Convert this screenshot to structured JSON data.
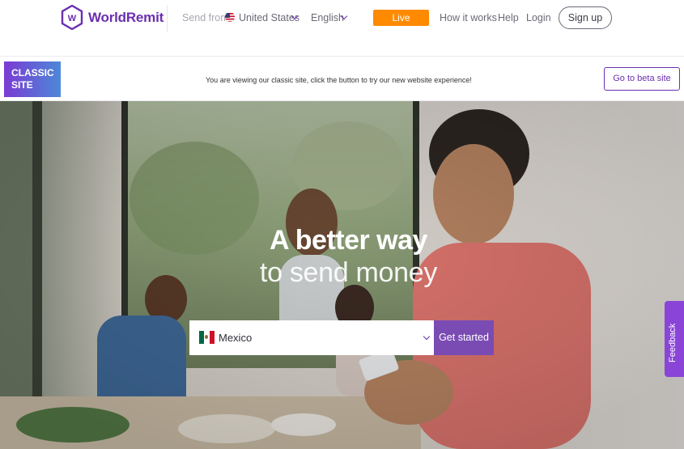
{
  "header": {
    "logo_text": "WorldRemit",
    "send_from_label": "Send from:",
    "send_from_country": "United States",
    "language": "English",
    "live_updates": "Live Updates",
    "nav": {
      "how_it_works": "How it works",
      "help": "Help",
      "login": "Login"
    },
    "signup": "Sign up"
  },
  "banner": {
    "badge_line1": "CLASSIC",
    "badge_line2": "SITE",
    "message": "You are viewing our classic site, click the button to try our new website experience!",
    "beta_button": "Go to beta site"
  },
  "hero": {
    "headline_1": "A better way",
    "headline_2": "to send money",
    "destination_country": "Mexico",
    "get_started": "Get started",
    "feedback": "Feedback"
  },
  "colors": {
    "brand_purple": "#6b2fb0",
    "live_orange": "#ff8a00",
    "get_started_purple": "#7a4bb3",
    "feedback_purple": "#8a45d8"
  },
  "icons": [
    "worldremit-logo-icon",
    "us-flag-icon",
    "chevron-down-icon",
    "mexico-flag-icon"
  ]
}
